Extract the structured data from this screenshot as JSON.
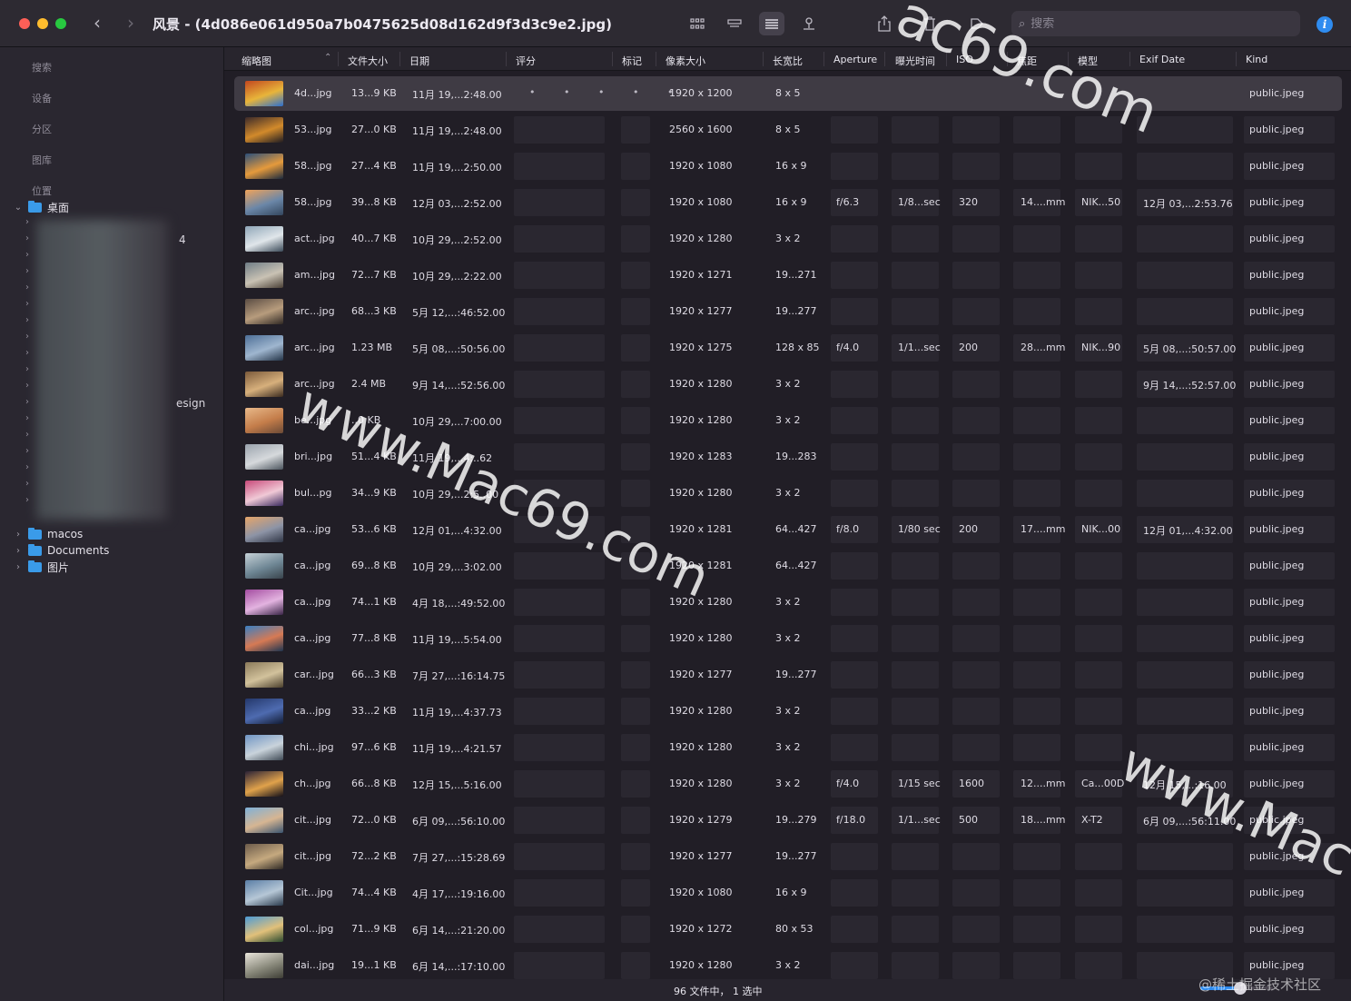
{
  "window": {
    "title": "风景 - (4d086e061d950a7b0475625d08d162d9f3d3c9e2.jpg)",
    "search_placeholder": "搜索"
  },
  "sidebar": {
    "sections": [
      "搜索",
      "设备",
      "分区",
      "图库",
      "位置"
    ],
    "tree": [
      {
        "label": "桌面",
        "expanded": true
      },
      {
        "label": "macos",
        "expanded": false
      },
      {
        "label": "Documents",
        "expanded": false
      },
      {
        "label": "图片",
        "expanded": false
      }
    ],
    "fragments": {
      "count": "4",
      "design": "esign"
    }
  },
  "columns": [
    "缩略图",
    "文件大小",
    "日期",
    "评分",
    "标记",
    "像素大小",
    "长宽比",
    "Aperture",
    "曝光时间",
    "ISO",
    "焦距",
    "模型",
    "Exif Date",
    "Kind"
  ],
  "rows": [
    {
      "name": "4d...jpg",
      "size": "13...9 KB",
      "date": "11月 19,...2:48.00",
      "pixels": "1920 x 1200",
      "ratio": "8 x 5",
      "aperture": "",
      "exposure": "",
      "iso": "",
      "focal": "",
      "model": "",
      "exif": "",
      "kind": "public.jpeg",
      "selected": true,
      "thumb": [
        "#c2471f",
        "#e8b53a",
        "#2b6fd0"
      ]
    },
    {
      "name": "53...jpg",
      "size": "27...0 KB",
      "date": "11月 19,...2:48.00",
      "pixels": "2560 x 1600",
      "ratio": "8 x 5",
      "aperture": "",
      "exposure": "",
      "iso": "",
      "focal": "",
      "model": "",
      "exif": "",
      "kind": "public.jpeg",
      "thumb": [
        "#3b2a2a",
        "#d28a2b",
        "#1e1b22"
      ]
    },
    {
      "name": "58...jpg",
      "size": "27...4 KB",
      "date": "11月 19,...2:50.00",
      "pixels": "1920 x 1080",
      "ratio": "16 x 9",
      "aperture": "",
      "exposure": "",
      "iso": "",
      "focal": "",
      "model": "",
      "exif": "",
      "kind": "public.jpeg",
      "thumb": [
        "#2b4f7a",
        "#e59a3c",
        "#1b2a3e"
      ]
    },
    {
      "name": "58...jpg",
      "size": "39...8 KB",
      "date": "12月 03,...2:52.00",
      "pixels": "1920 x 1080",
      "ratio": "16 x 9",
      "aperture": "f/6.3",
      "exposure": "1/8...sec",
      "iso": "320",
      "focal": "14....mm",
      "model": "NIK...50",
      "exif": "12月 03,...2:53.76",
      "kind": "public.jpeg",
      "thumb": [
        "#f0a35a",
        "#6b87a8",
        "#33465d"
      ]
    },
    {
      "name": "act...jpg",
      "size": "40...7 KB",
      "date": "10月 29,...2:52.00",
      "pixels": "1920 x 1280",
      "ratio": "3 x 2",
      "aperture": "",
      "exposure": "",
      "iso": "",
      "focal": "",
      "model": "",
      "exif": "",
      "kind": "public.jpeg",
      "thumb": [
        "#8fa6b8",
        "#e0e6ea",
        "#3b4a58"
      ]
    },
    {
      "name": "am...jpg",
      "size": "72...7 KB",
      "date": "10月 29,...2:22.00",
      "pixels": "1920 x 1271",
      "ratio": "19...271",
      "aperture": "",
      "exposure": "",
      "iso": "",
      "focal": "",
      "model": "",
      "exif": "",
      "kind": "public.jpeg",
      "thumb": [
        "#6f7d86",
        "#c9c2b4",
        "#4a4036"
      ]
    },
    {
      "name": "arc...jpg",
      "size": "68...3 KB",
      "date": "5月 12,...:46:52.00",
      "pixels": "1920 x 1277",
      "ratio": "19...277",
      "aperture": "",
      "exposure": "",
      "iso": "",
      "focal": "",
      "model": "",
      "exif": "",
      "kind": "public.jpeg",
      "thumb": [
        "#5a4c43",
        "#b79c7d",
        "#2f2823"
      ]
    },
    {
      "name": "arc...jpg",
      "size": "1.23 MB",
      "date": "5月 08,...:50:56.00",
      "pixels": "1920 x 1275",
      "ratio": "128 x 85",
      "aperture": "f/4.0",
      "exposure": "1/1...sec",
      "iso": "200",
      "focal": "28....mm",
      "model": "NIK...90",
      "exif": "5月 08,...:50:57.00",
      "kind": "public.jpeg",
      "thumb": [
        "#4d6f97",
        "#9fb6cf",
        "#243447"
      ]
    },
    {
      "name": "arc...jpg",
      "size": "2.4 MB",
      "date": "9月 14,...:52:56.00",
      "pixels": "1920 x 1280",
      "ratio": "3 x 2",
      "aperture": "",
      "exposure": "",
      "iso": "",
      "focal": "",
      "model": "",
      "exif": "9月 14,...:52:57.00",
      "kind": "public.jpeg",
      "thumb": [
        "#7b5a3b",
        "#d7b07c",
        "#3b2b1f"
      ]
    },
    {
      "name": "be...jpg",
      "size": "..0 KB",
      "date": "10月 29,...7:00.00",
      "pixels": "1920 x 1280",
      "ratio": "3 x 2",
      "aperture": "",
      "exposure": "",
      "iso": "",
      "focal": "",
      "model": "",
      "exif": "",
      "kind": "public.jpeg",
      "thumb": [
        "#e8b98a",
        "#c47d4a",
        "#6b4a36"
      ]
    },
    {
      "name": "bri...jpg",
      "size": "51...4 KB",
      "date": "11月 19,...4:..62",
      "pixels": "1920 x 1283",
      "ratio": "19...283",
      "aperture": "",
      "exposure": "",
      "iso": "",
      "focal": "",
      "model": "",
      "exif": "",
      "kind": "public.jpeg",
      "thumb": [
        "#9aa3ad",
        "#d6d9dc",
        "#4b545d"
      ]
    },
    {
      "name": "bul...pg",
      "size": "34...9 KB",
      "date": "10月 29,...2:5..00",
      "pixels": "1920 x 1280",
      "ratio": "3 x 2",
      "aperture": "",
      "exposure": "",
      "iso": "",
      "focal": "",
      "model": "",
      "exif": "",
      "kind": "public.jpeg",
      "thumb": [
        "#c84a7a",
        "#f0c9d6",
        "#3a2a5e"
      ]
    },
    {
      "name": "ca...jpg",
      "size": "53...6 KB",
      "date": "12月 01,...4:32.00",
      "pixels": "1920 x 1281",
      "ratio": "64...427",
      "aperture": "f/8.0",
      "exposure": "1/80 sec",
      "iso": "200",
      "focal": "17....mm",
      "model": "NIK...00",
      "exif": "12月 01,...4:32.00",
      "kind": "public.jpeg",
      "thumb": [
        "#e6a56a",
        "#8d94a6",
        "#2f3545"
      ]
    },
    {
      "name": "ca...jpg",
      "size": "69...8 KB",
      "date": "10月 29,...3:02.00",
      "pixels": "1920 x 1281",
      "ratio": "64...427",
      "aperture": "",
      "exposure": "",
      "iso": "",
      "focal": "",
      "model": "",
      "exif": "",
      "kind": "public.jpeg",
      "thumb": [
        "#c6d2d8",
        "#6f8795",
        "#39444c"
      ]
    },
    {
      "name": "ca...jpg",
      "size": "74...1 KB",
      "date": "4月 18,...:49:52.00",
      "pixels": "1920 x 1280",
      "ratio": "3 x 2",
      "aperture": "",
      "exposure": "",
      "iso": "",
      "focal": "",
      "model": "",
      "exif": "",
      "kind": "public.jpeg",
      "thumb": [
        "#a34ca0",
        "#e3b3e0",
        "#3a2547"
      ]
    },
    {
      "name": "ca...jpg",
      "size": "77...8 KB",
      "date": "11月 19,...5:54.00",
      "pixels": "1920 x 1280",
      "ratio": "3 x 2",
      "aperture": "",
      "exposure": "",
      "iso": "",
      "focal": "",
      "model": "",
      "exif": "",
      "kind": "public.jpeg",
      "thumb": [
        "#3a7fc2",
        "#d67a54",
        "#1f3550"
      ]
    },
    {
      "name": "car...jpg",
      "size": "66...3 KB",
      "date": "7月 27,...:16:14.75",
      "pixels": "1920 x 1277",
      "ratio": "19...277",
      "aperture": "",
      "exposure": "",
      "iso": "",
      "focal": "",
      "model": "",
      "exif": "",
      "kind": "public.jpeg",
      "thumb": [
        "#8b7a5a",
        "#d2c29c",
        "#4a3f2c"
      ]
    },
    {
      "name": "ca...jpg",
      "size": "33...2 KB",
      "date": "11月 19,...4:37.73",
      "pixels": "1920 x 1280",
      "ratio": "3 x 2",
      "aperture": "",
      "exposure": "",
      "iso": "",
      "focal": "",
      "model": "",
      "exif": "",
      "kind": "public.jpeg",
      "thumb": [
        "#24386b",
        "#4e6bb0",
        "#121b33"
      ]
    },
    {
      "name": "chi...jpg",
      "size": "97...6 KB",
      "date": "11月 19,...4:21.57",
      "pixels": "1920 x 1280",
      "ratio": "3 x 2",
      "aperture": "",
      "exposure": "",
      "iso": "",
      "focal": "",
      "model": "",
      "exif": "",
      "kind": "public.jpeg",
      "thumb": [
        "#6f95c4",
        "#c9d3db",
        "#3f4a55"
      ]
    },
    {
      "name": "ch...jpg",
      "size": "66...8 KB",
      "date": "12月 15,...5:16.00",
      "pixels": "1920 x 1280",
      "ratio": "3 x 2",
      "aperture": "f/4.0",
      "exposure": "1/15 sec",
      "iso": "1600",
      "focal": "12....mm",
      "model": "Ca...00D",
      "exif": "12月 15,...:16.00",
      "kind": "public.jpeg",
      "thumb": [
        "#2a2236",
        "#e0a24b",
        "#141019"
      ]
    },
    {
      "name": "cit...jpg",
      "size": "72...0 KB",
      "date": "6月 09,...:56:10.00",
      "pixels": "1920 x 1279",
      "ratio": "19...279",
      "aperture": "f/18.0",
      "exposure": "1/1...sec",
      "iso": "500",
      "focal": "18....mm",
      "model": "X-T2",
      "exif": "6月 09,...:56:11.00",
      "kind": "public.jpeg",
      "thumb": [
        "#7fb1d9",
        "#d6b592",
        "#3a5470"
      ]
    },
    {
      "name": "cit...jpg",
      "size": "72...2 KB",
      "date": "7月 27,...:15:28.69",
      "pixels": "1920 x 1277",
      "ratio": "19...277",
      "aperture": "",
      "exposure": "",
      "iso": "",
      "focal": "",
      "model": "",
      "exif": "",
      "kind": "public.jpeg",
      "thumb": [
        "#6c5b4a",
        "#c5a97f",
        "#2f2a25"
      ]
    },
    {
      "name": "Cit...jpg",
      "size": "74...4 KB",
      "date": "4月 17,...:19:16.00",
      "pixels": "1920 x 1080",
      "ratio": "16 x 9",
      "aperture": "",
      "exposure": "",
      "iso": "",
      "focal": "",
      "model": "",
      "exif": "",
      "kind": "public.jpeg",
      "thumb": [
        "#5a7ea6",
        "#b6c7d6",
        "#2a3a4c"
      ]
    },
    {
      "name": "col...jpg",
      "size": "71...9 KB",
      "date": "6月 14,...:21:20.00",
      "pixels": "1920 x 1272",
      "ratio": "80 x 53",
      "aperture": "",
      "exposure": "",
      "iso": "",
      "focal": "",
      "model": "",
      "exif": "",
      "kind": "public.jpeg",
      "thumb": [
        "#4c9bd6",
        "#e1c07a",
        "#2b4a2e"
      ]
    },
    {
      "name": "dai...jpg",
      "size": "19...1 KB",
      "date": "6月 14,...:17:10.00",
      "pixels": "1920 x 1280",
      "ratio": "3 x 2",
      "aperture": "",
      "exposure": "",
      "iso": "",
      "focal": "",
      "model": "",
      "exif": "",
      "kind": "public.jpeg",
      "thumb": [
        "#eae6dc",
        "#8a8a7c",
        "#3d3d35"
      ]
    }
  ],
  "rating_dots": "• • • • •",
  "status": {
    "text": "96 文件中， 1 选中",
    "zoom_fraction": 0.55
  },
  "watermarks": [
    "ac69.com",
    "www.Mac69.com",
    "www.Mac",
    "@稀土掘金技术社区"
  ],
  "colors": {
    "accent": "#2f8cf0",
    "folder": "#3a9be9",
    "selection": "#3f3b44"
  }
}
